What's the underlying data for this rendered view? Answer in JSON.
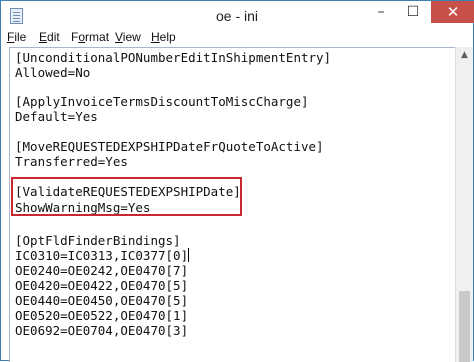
{
  "window": {
    "title": "oe - ini",
    "minimize_glyph": "–",
    "maximize_glyph": "☐",
    "close_glyph": "✕"
  },
  "menu": [
    {
      "mnemonic": "F",
      "rest": "ile"
    },
    {
      "mnemonic": "E",
      "rest": "dit"
    },
    {
      "mnemonic": "F",
      "rest": "o",
      "tail": "rmat",
      "label": "Format"
    },
    {
      "mnemonic": "V",
      "rest": "iew"
    },
    {
      "mnemonic": "H",
      "rest": "elp"
    }
  ],
  "menu_labels": {
    "file": {
      "m": "F",
      "r": "ile"
    },
    "edit": {
      "m": "E",
      "r": "dit"
    },
    "format_pre": "F",
    "format_m": "o",
    "format_post": "rmat",
    "view": {
      "m": "V",
      "r": "iew"
    },
    "help": {
      "m": "H",
      "r": "elp"
    }
  },
  "content": {
    "lines": [
      "[UnconditionalPONumberEditInShipmentEntry]",
      "Allowed=No",
      "",
      "[ApplyInvoiceTermsDiscountToMiscCharge]",
      "Default=Yes",
      "",
      "[MoveREQUESTEDEXPSHIPDateFrQuoteToActive]",
      "Transferred=Yes",
      "",
      "[ValidateREQUESTEDEXPSHIPDate]",
      "ShowWarningMsg=Yes",
      "",
      "[OptFldFinderBindings]",
      "IC0310=IC0313,IC0377[0]",
      "OE0240=OE0242,OE0470[7]",
      "OE0420=OE0422,OE0470[5]",
      "OE0440=OE0450,OE0470[5]",
      "OE0520=OE0522,OE0470[1]",
      "OE0692=OE0704,OE0470[3]"
    ]
  },
  "scrollbar": {
    "up_arrow_glyph": "▲"
  },
  "colors": {
    "highlight_border": "#c8282f",
    "close_button": "#c7504b",
    "window_border": "#3c7fb1"
  }
}
